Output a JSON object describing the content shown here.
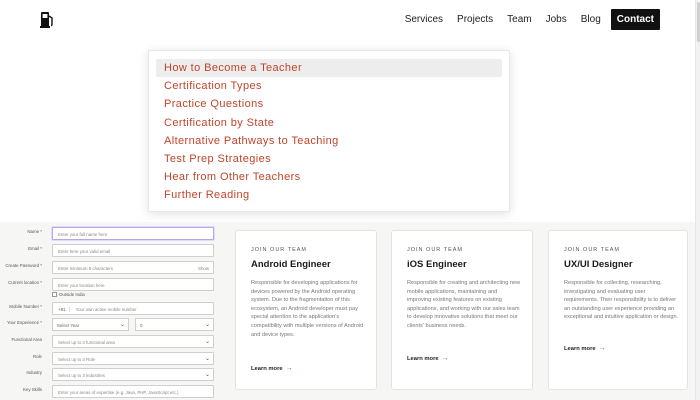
{
  "header": {
    "nav": [
      "Services",
      "Projects",
      "Team",
      "Jobs",
      "Blog",
      "Contact"
    ]
  },
  "dropdown": {
    "items": [
      "How to Become a Teacher",
      "Certification Types",
      "Practice Questions",
      "Certification by State",
      "Alternative Pathways to Teaching",
      "Test Prep Strategies",
      "Hear from Other Teachers",
      "Further Reading"
    ],
    "active_index": 0
  },
  "form": {
    "fields": [
      {
        "label": "Name *",
        "placeholder": "Enter your full name here"
      },
      {
        "label": "Email *",
        "placeholder": "Enter here your valid email"
      },
      {
        "label": "Create Password *",
        "placeholder": "Enter minimum 8 characters",
        "action": "Show"
      },
      {
        "label": "Current location *",
        "placeholder": "Enter your location here"
      },
      {
        "label": "Mobile Number *",
        "placeholder": "Your own active mobile number"
      },
      {
        "label": "Your Experience *",
        "select_year": "Select Year",
        "select_month": "0"
      },
      {
        "label": "Functional Area",
        "placeholder": "Select up to 3 functional area"
      },
      {
        "label": "Role",
        "placeholder": "Select up to 3 Role"
      },
      {
        "label": "Industry",
        "placeholder": "Select up to 3 industries"
      },
      {
        "label": "Key Skills",
        "placeholder": "Enter your areas of expertise (e.g. Java, PHP, JavaScript etc.)"
      }
    ],
    "checkbox_label": "Outside India",
    "country_code": "+91"
  },
  "cards": [
    {
      "eyebrow": "JOIN OUR TEAM",
      "title": "Android Engineer",
      "description": "Responsible for developing applications for devices powered by the Android operating system. Due to the fragmentation of this ecosystem, an Android developer must pay special attention to the application's compatibility with multiple versions of Android and device types.",
      "link": "Learn more"
    },
    {
      "eyebrow": "JOIN OUR TEAM",
      "title": "iOS Engineer",
      "description": "Responsible for creating and architecting new mobile applications, maintaining and improving existing features on existing applications, and working with our sales team to develop innovative solutions that meet our clients' business needs.",
      "link": "Learn more"
    },
    {
      "eyebrow": "JOIN OUR TEAM",
      "title": "UX/UI Designer",
      "description": "Responsible for collecting, researching, investigating and evaluating user requirements. Their responsibility is to deliver an outstanding user experience providing an exceptional and intuitive application or design.",
      "link": "Learn more"
    }
  ],
  "colors": {
    "dropdown_text": "#c0452a",
    "link_arrow": "#d12c7d",
    "contact_bg": "#111111"
  }
}
